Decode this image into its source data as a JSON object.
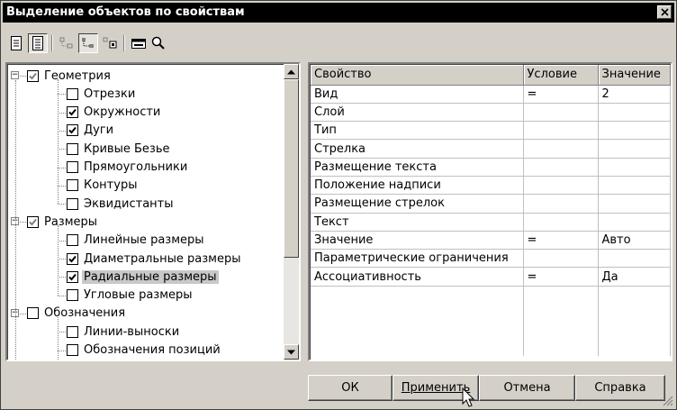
{
  "window": {
    "title": "Выделение объектов по свойствам"
  },
  "toolbar": {
    "buttons": [
      {
        "icon": "page-icon",
        "pressed": false
      },
      {
        "icon": "page-lines-icon",
        "pressed": true
      },
      {
        "icon": "tree-collapse-icon",
        "pressed": false
      },
      {
        "icon": "tree-expand-icon",
        "pressed": true
      },
      {
        "icon": "tree-select-icon",
        "pressed": false
      },
      {
        "icon": "window-icon",
        "pressed": false
      },
      {
        "icon": "zoom-icon",
        "pressed": false
      }
    ]
  },
  "tree": {
    "items": [
      {
        "label": "Геометрия",
        "level": 0,
        "state": "grayed",
        "expander": "−"
      },
      {
        "label": "Отрезки",
        "level": 1,
        "state": "unchecked"
      },
      {
        "label": "Окружности",
        "level": 1,
        "state": "checked"
      },
      {
        "label": "Дуги",
        "level": 1,
        "state": "checked"
      },
      {
        "label": "Кривые Безье",
        "level": 1,
        "state": "unchecked"
      },
      {
        "label": "Прямоугольники",
        "level": 1,
        "state": "unchecked"
      },
      {
        "label": "Контуры",
        "level": 1,
        "state": "unchecked"
      },
      {
        "label": "Эквидистанты",
        "level": 1,
        "state": "unchecked"
      },
      {
        "label": "Размеры",
        "level": 0,
        "state": "grayed",
        "expander": "−"
      },
      {
        "label": "Линейные размеры",
        "level": 1,
        "state": "unchecked"
      },
      {
        "label": "Диаметральные размеры",
        "level": 1,
        "state": "checked"
      },
      {
        "label": "Радиальные размеры",
        "level": 1,
        "state": "checked",
        "selected": true
      },
      {
        "label": "Угловые размеры",
        "level": 1,
        "state": "unchecked"
      },
      {
        "label": "Обозначения",
        "level": 0,
        "state": "unchecked",
        "expander": "−"
      },
      {
        "label": "Линии-выноски",
        "level": 1,
        "state": "unchecked"
      },
      {
        "label": "Обозначения позиций",
        "level": 1,
        "state": "unchecked"
      }
    ]
  },
  "properties": {
    "columns": [
      "Свойство",
      "Условие",
      "Значение"
    ],
    "rows": [
      [
        "Вид",
        "=",
        "2"
      ],
      [
        "Слой",
        "",
        ""
      ],
      [
        "Тип",
        "",
        ""
      ],
      [
        "Стрелка",
        "",
        ""
      ],
      [
        "Размещение текста",
        "",
        ""
      ],
      [
        "Положение надписи",
        "",
        ""
      ],
      [
        "Размещение стрелок",
        "",
        ""
      ],
      [
        "Текст",
        "",
        ""
      ],
      [
        "Значение",
        "=",
        "Авто"
      ],
      [
        "Параметрические ограничения",
        "",
        ""
      ],
      [
        "Ассоциативность",
        "=",
        "Да"
      ]
    ]
  },
  "buttons": {
    "ok": "ОК",
    "apply": "Применить",
    "cancel": "Отмена",
    "help": "Справка"
  }
}
